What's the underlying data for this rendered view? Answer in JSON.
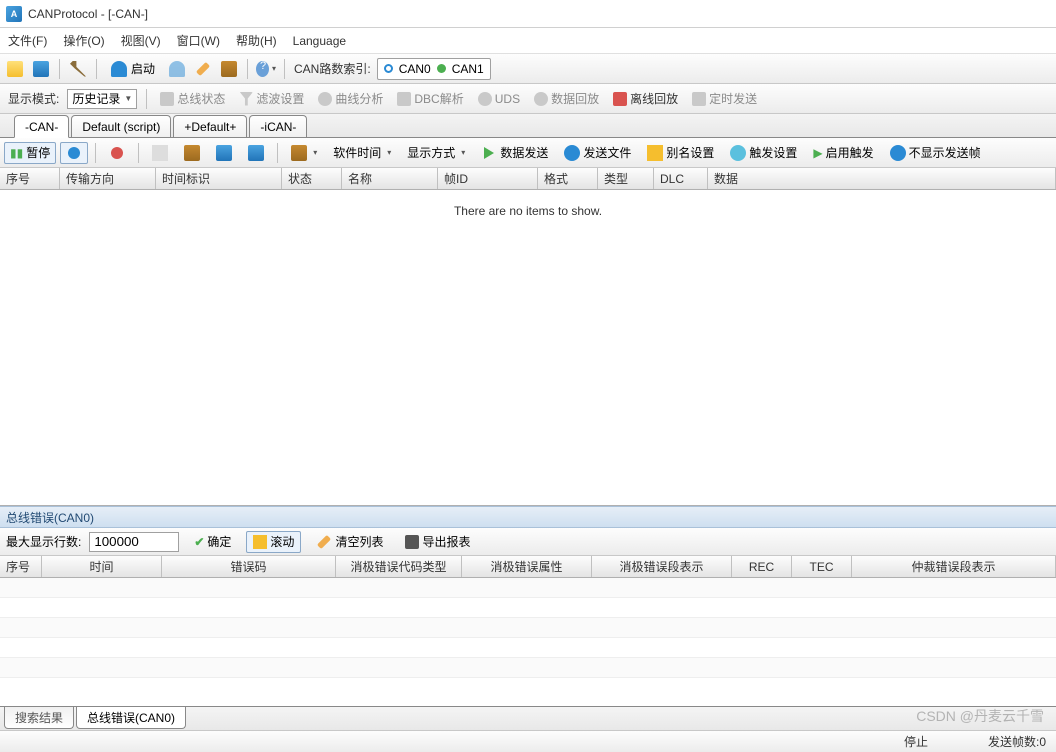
{
  "title": "CANProtocol - [-CAN-]",
  "menu": {
    "file": "文件(F)",
    "operate": "操作(O)",
    "view": "视图(V)",
    "window": "窗口(W)",
    "help": "帮助(H)",
    "language": "Language"
  },
  "toolbar1": {
    "launch": "启动",
    "can_index_label": "CAN路数索引:",
    "can0": "CAN0",
    "can1": "CAN1"
  },
  "toolbar2": {
    "display_mode_label": "显示模式:",
    "display_mode_value": "历史记录",
    "bus_status": "总线状态",
    "filter_settings": "滤波设置",
    "curve_analysis": "曲线分析",
    "dbc_parse": "DBC解析",
    "uds": "UDS",
    "data_replay": "数据回放",
    "offline_playback": "离线回放",
    "timed_send": "定时发送"
  },
  "tabs": {
    "t1": "-CAN-",
    "t2": "Default (script)",
    "t3": "+Default+",
    "t4": "-iCAN-"
  },
  "toolbar3": {
    "pause": "暂停",
    "software_time": "软件时间",
    "display_style": "显示方式",
    "data_send": "数据发送",
    "send_file": "发送文件",
    "alias_settings": "别名设置",
    "trigger_settings": "触发设置",
    "enable_trigger": "启用触发",
    "hide_send_frame": "不显示发送帧"
  },
  "grid_cols": {
    "seq": "序号",
    "dir": "传输方向",
    "time": "时间标识",
    "status": "状态",
    "name": "名称",
    "frame_id": "帧ID",
    "format": "格式",
    "type": "类型",
    "dlc": "DLC",
    "data": "数据"
  },
  "empty_text": "There are no items to show.",
  "bus_error": {
    "title": "总线错误(CAN0)",
    "max_rows_label": "最大显示行数:",
    "max_rows_value": "100000",
    "confirm": "确定",
    "scroll": "滚动",
    "clear_list": "清空列表",
    "export_report": "导出报表",
    "cols": {
      "seq": "序号",
      "time": "时间",
      "err_code": "错误码",
      "passive_type": "消极错误代码类型",
      "passive_attr": "消极错误属性",
      "passive_seg": "消极错误段表示",
      "rec": "REC",
      "tec": "TEC",
      "arb_seg": "仲裁错误段表示"
    }
  },
  "bottom_tabs": {
    "search": "搜索结果",
    "bus_err": "总线错误(CAN0)"
  },
  "status": {
    "stop": "停止",
    "send_frames": "发送帧数:0"
  },
  "watermark": "CSDN @丹麦云千雪"
}
